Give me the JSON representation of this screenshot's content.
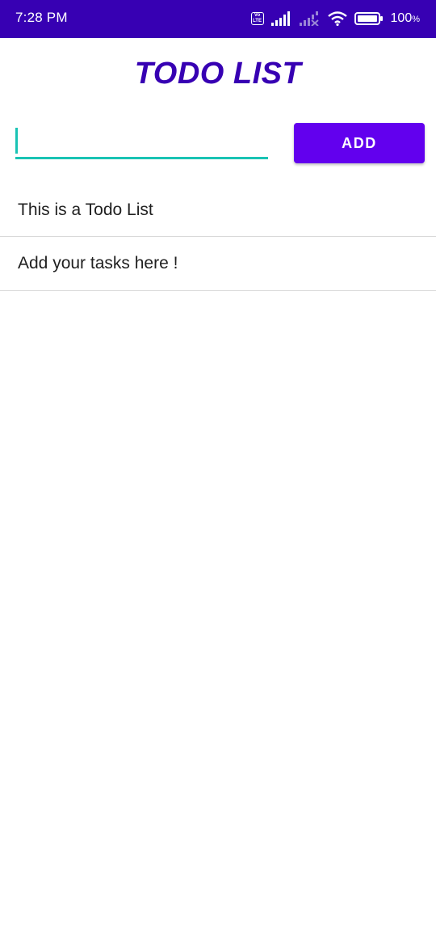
{
  "status_bar": {
    "time": "7:28 PM",
    "volte_label": "Vo LTE",
    "battery_percent": "100",
    "battery_percent_sign": "%",
    "background_color": "#3700b3"
  },
  "header": {
    "title": "TODO LIST",
    "title_color": "#3700b3"
  },
  "input": {
    "value": "",
    "placeholder": "",
    "accent_color": "#19c3b4"
  },
  "add_button": {
    "label": "ADD",
    "color": "#6200ee"
  },
  "todo_items": [
    {
      "text": "This is a Todo List"
    },
    {
      "text": "Add your tasks here !"
    }
  ]
}
